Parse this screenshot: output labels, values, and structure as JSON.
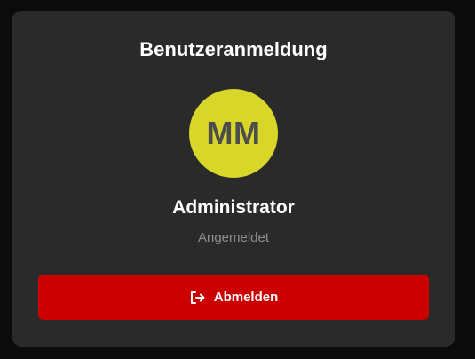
{
  "card": {
    "title": "Benutzeranmeldung"
  },
  "user": {
    "initials": "MM",
    "name": "Administrator",
    "status": "Angemeldet"
  },
  "actions": {
    "logout_label": "Abmelden",
    "logout_icon": "logout-icon"
  },
  "colors": {
    "card_background": "#2a2a2a",
    "avatar_background": "#d9d62a",
    "avatar_text": "#4d4d4d",
    "logout_button": "#cc0000",
    "status_text": "#8f8f8f"
  }
}
